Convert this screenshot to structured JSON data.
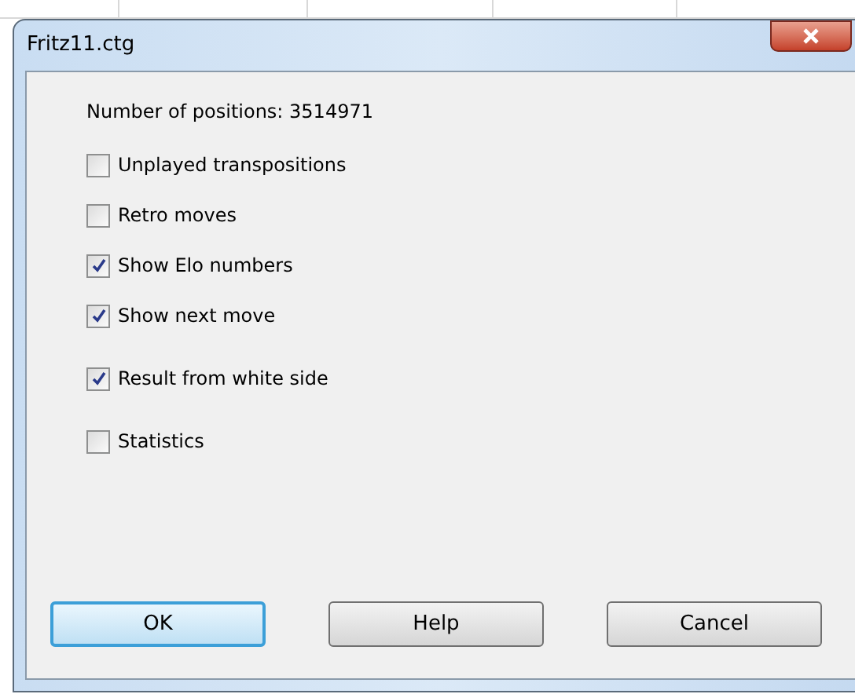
{
  "window": {
    "title": "Fritz11.ctg"
  },
  "info": "Number of positions: 3514971",
  "option_groups": [
    [
      {
        "label": "Unplayed transpositions",
        "checked": false
      },
      {
        "label": "Retro moves",
        "checked": false
      },
      {
        "label": "Show Elo numbers",
        "checked": true
      },
      {
        "label": "Show next move",
        "checked": true
      }
    ],
    [
      {
        "label": "Result from white side",
        "checked": true
      }
    ],
    [
      {
        "label": "Statistics",
        "checked": false
      }
    ]
  ],
  "buttons": [
    {
      "label": "OK",
      "default": true
    },
    {
      "label": "Help",
      "default": false
    },
    {
      "label": "Cancel",
      "default": false
    }
  ]
}
